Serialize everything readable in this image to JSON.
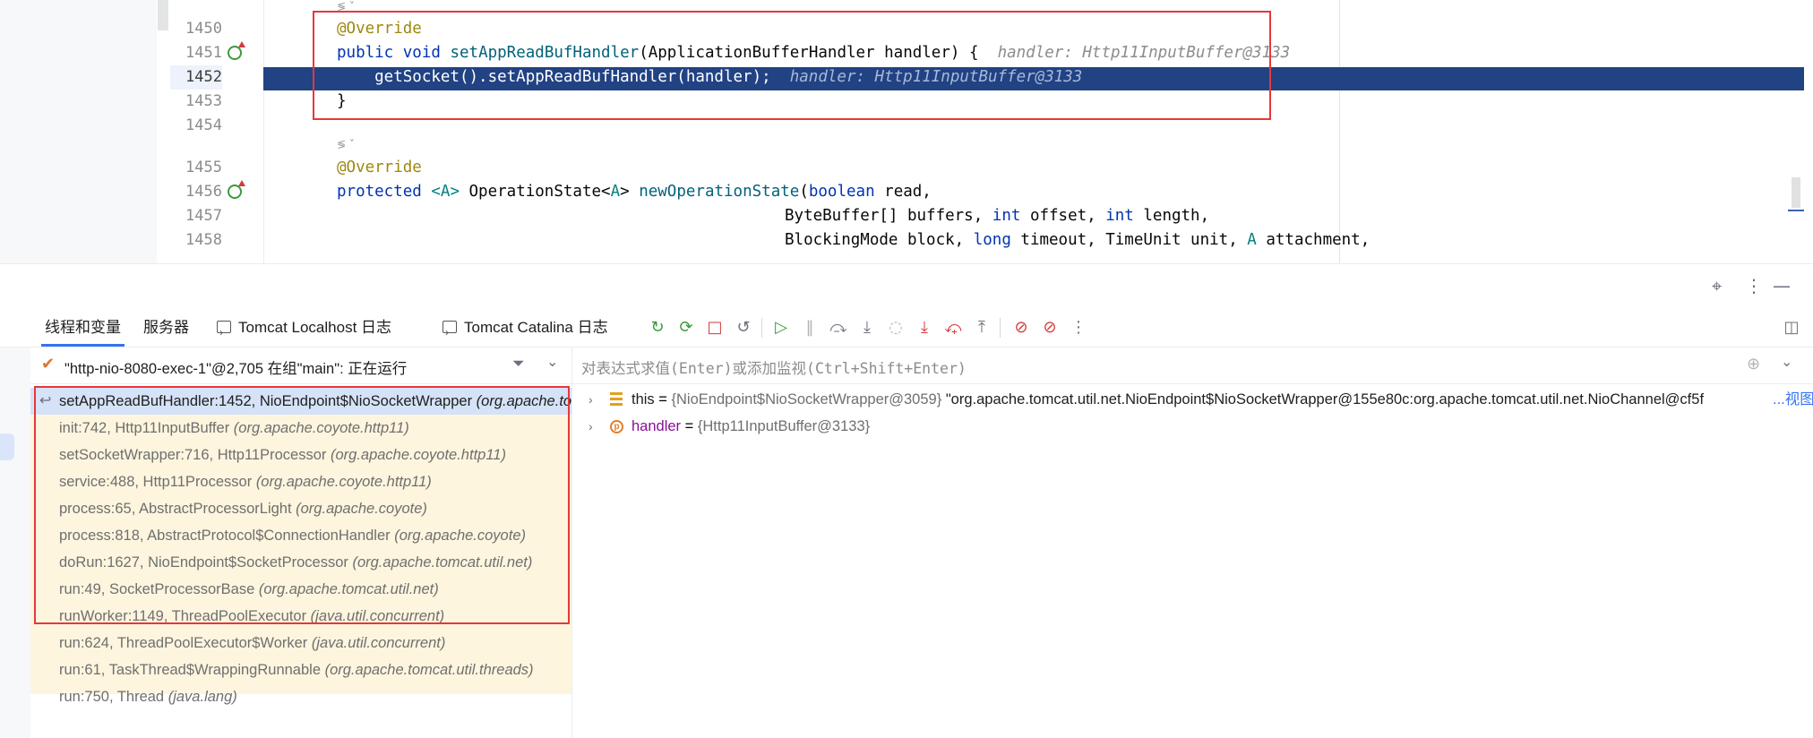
{
  "editor": {
    "lines": [
      {
        "num": "1450"
      },
      {
        "num": "1451"
      },
      {
        "num": "1452"
      },
      {
        "num": "1453"
      },
      {
        "num": "1454"
      },
      {
        "num": "1455"
      },
      {
        "num": "1456"
      },
      {
        "num": "1457"
      },
      {
        "num": "1458"
      }
    ],
    "code": {
      "l1450_ann": "@Override",
      "l1451_kw1": "public",
      "l1451_kw2": "void",
      "l1451_fn": "setAppReadBufHandler",
      "l1451_rest": "(ApplicationBufferHandler handler) {",
      "l1451_hint": "handler: Http11InputBuffer@3133",
      "l1452_code": "    getSocket().setAppReadBufHandler(handler);",
      "l1452_hint": "handler: Http11InputBuffer@3133",
      "l1453_code": "}",
      "l1455_ann": "@Override",
      "l1456_kw1": "protected",
      "l1456_t1": "<A>",
      "l1456_mid": " OperationState<",
      "l1456_t2": "A",
      "l1456_mid2": "> ",
      "l1456_fn": "newOperationState",
      "l1456_p": "(",
      "l1456_kw3": "boolean",
      "l1456_rest": " read,",
      "l1457_a": "ByteBuffer[] buffers, ",
      "l1457_kw1": "int",
      "l1457_b": " offset, ",
      "l1457_kw2": "int",
      "l1457_c": " length,",
      "l1458_a": "BlockingMode block, ",
      "l1458_kw1": "long",
      "l1458_b": " timeout, TimeUnit unit, ",
      "l1458_t": "A",
      "l1458_c": " attachment,"
    }
  },
  "tabs": [
    {
      "label": "线程和变量"
    },
    {
      "label": "服务器"
    },
    {
      "label": "Tomcat Localhost 日志"
    },
    {
      "label": "Tomcat Catalina 日志"
    }
  ],
  "thread": {
    "label": "\"http-nio-8080-exec-1\"@2,705 在组\"main\": 正在运行"
  },
  "frames": [
    {
      "name": "setAppReadBufHandler:1452, NioEndpoint$NioSocketWrapper",
      "pkg": "(org.apache.tomcat.util.net)"
    },
    {
      "name": "init:742, Http11InputBuffer",
      "pkg": "(org.apache.coyote.http11)"
    },
    {
      "name": "setSocketWrapper:716, Http11Processor",
      "pkg": "(org.apache.coyote.http11)"
    },
    {
      "name": "service:488, Http11Processor",
      "pkg": "(org.apache.coyote.http11)"
    },
    {
      "name": "process:65, AbstractProcessorLight",
      "pkg": "(org.apache.coyote)"
    },
    {
      "name": "process:818, AbstractProtocol$ConnectionHandler",
      "pkg": "(org.apache.coyote)"
    },
    {
      "name": "doRun:1627, NioEndpoint$SocketProcessor",
      "pkg": "(org.apache.tomcat.util.net)"
    },
    {
      "name": "run:49, SocketProcessorBase",
      "pkg": "(org.apache.tomcat.util.net)"
    },
    {
      "name": "runWorker:1149, ThreadPoolExecutor",
      "pkg": "(java.util.concurrent)"
    },
    {
      "name": "run:624, ThreadPoolExecutor$Worker",
      "pkg": "(java.util.concurrent)"
    },
    {
      "name": "run:61, TaskThread$WrappingRunnable",
      "pkg": "(org.apache.tomcat.util.threads)"
    },
    {
      "name": "run:750, Thread",
      "pkg": "(java.lang)"
    }
  ],
  "evaluate": {
    "placeholder": "对表达式求值(Enter)或添加监视(Ctrl+Shift+Enter)"
  },
  "variables": [
    {
      "name": "this",
      "eq": " = ",
      "ref": "{NioEndpoint$NioSocketWrapper@3059}",
      "value": " \"org.apache.tomcat.util.net.NioEndpoint$NioSocketWrapper@155e80c:org.apache.tomcat.util.net.NioChannel@cf5f",
      "link": "...视图"
    },
    {
      "name": "handler",
      "eq": " = ",
      "ref": "{Http11InputBuffer@3133}"
    }
  ],
  "colors": {
    "highlight": "#214283",
    "annotation_box": "#e5383b",
    "frames_bg": "#fdf5de",
    "tab_underline": "#3574f0"
  },
  "icons": [
    "restart-icon",
    "rerun-icon",
    "stop-icon",
    "refresh-icon",
    "resume-icon",
    "pause-icon",
    "step-over-icon",
    "step-into-icon",
    "force-step-into-icon",
    "smart-step-into-icon",
    "force-return-icon",
    "step-out-icon",
    "view-breakpoints-icon",
    "mute-breakpoints-icon",
    "more-icon",
    "target-icon",
    "minimize-icon",
    "layout-icon",
    "filter-icon",
    "add-watch-icon"
  ]
}
